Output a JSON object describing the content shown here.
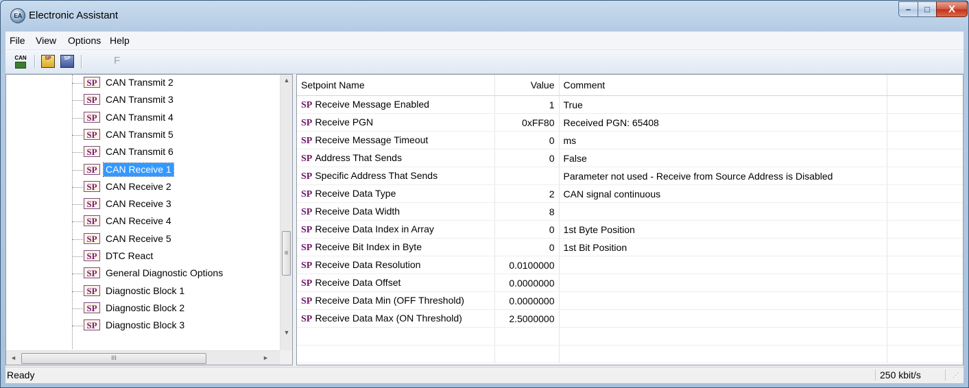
{
  "window": {
    "title": "Electronic Assistant",
    "app_icon_text": "EA"
  },
  "window_controls": {
    "minimize": "–",
    "maximize": "□",
    "close": "X"
  },
  "menu": {
    "items": [
      "File",
      "View",
      "Options",
      "Help"
    ]
  },
  "toolbar": {
    "buttons": [
      {
        "icon": "can-connect-icon",
        "text": "CAN"
      },
      {
        "icon": "open-setpoint-file-icon",
        "text": "SP"
      },
      {
        "icon": "save-setpoint-file-icon",
        "text": "SP"
      },
      {
        "icon": "flash-icon",
        "text": "F"
      }
    ]
  },
  "tree": {
    "badge": "SP",
    "selected_index": 5,
    "items": [
      "CAN Transmit 2",
      "CAN Transmit 3",
      "CAN Transmit 4",
      "CAN Transmit 5",
      "CAN Transmit 6",
      "CAN Receive 1",
      "CAN Receive 2",
      "CAN Receive 3",
      "CAN Receive 4",
      "CAN Receive 5",
      "DTC React",
      "General Diagnostic Options",
      "Diagnostic Block 1",
      "Diagnostic Block 2",
      "Diagnostic Block 3"
    ],
    "scroll_arrows": {
      "up": "▲",
      "down": "▼",
      "left": "◄",
      "right": "►"
    },
    "scroll_grip_v": "≡",
    "scroll_grip_h": "III"
  },
  "grid": {
    "headers": {
      "name": "Setpoint Name",
      "value": "Value",
      "comment": "Comment"
    },
    "tag": "SP",
    "rows": [
      {
        "name": "Receive Message Enabled",
        "value": "1",
        "comment": "True"
      },
      {
        "name": "Receive PGN",
        "value": "0xFF80",
        "comment": "Received PGN: 65408"
      },
      {
        "name": "Receive Message Timeout",
        "value": "0",
        "comment": "ms"
      },
      {
        "name": "Address That Sends",
        "value": "0",
        "comment": "False"
      },
      {
        "name": "Specific Address That Sends",
        "value": "",
        "comment": "Parameter not used - Receive from Source Address is Disabled"
      },
      {
        "name": "Receive Data Type",
        "value": "2",
        "comment": "CAN signal continuous"
      },
      {
        "name": "Receive Data Width",
        "value": "8",
        "comment": ""
      },
      {
        "name": "Receive Data Index in Array",
        "value": "0",
        "comment": "1st Byte Position"
      },
      {
        "name": "Receive Bit Index in Byte",
        "value": "0",
        "comment": "1st Bit Position"
      },
      {
        "name": "Receive Data Resolution",
        "value": "0.0100000",
        "comment": ""
      },
      {
        "name": "Receive Data Offset",
        "value": "0.0000000",
        "comment": ""
      },
      {
        "name": "Receive Data Min (OFF Threshold)",
        "value": "0.0000000",
        "comment": ""
      },
      {
        "name": "Receive Data Max (ON Threshold)",
        "value": "2.5000000",
        "comment": ""
      }
    ]
  },
  "status": {
    "text": "Ready",
    "baud_rate": "250 kbit/s"
  }
}
